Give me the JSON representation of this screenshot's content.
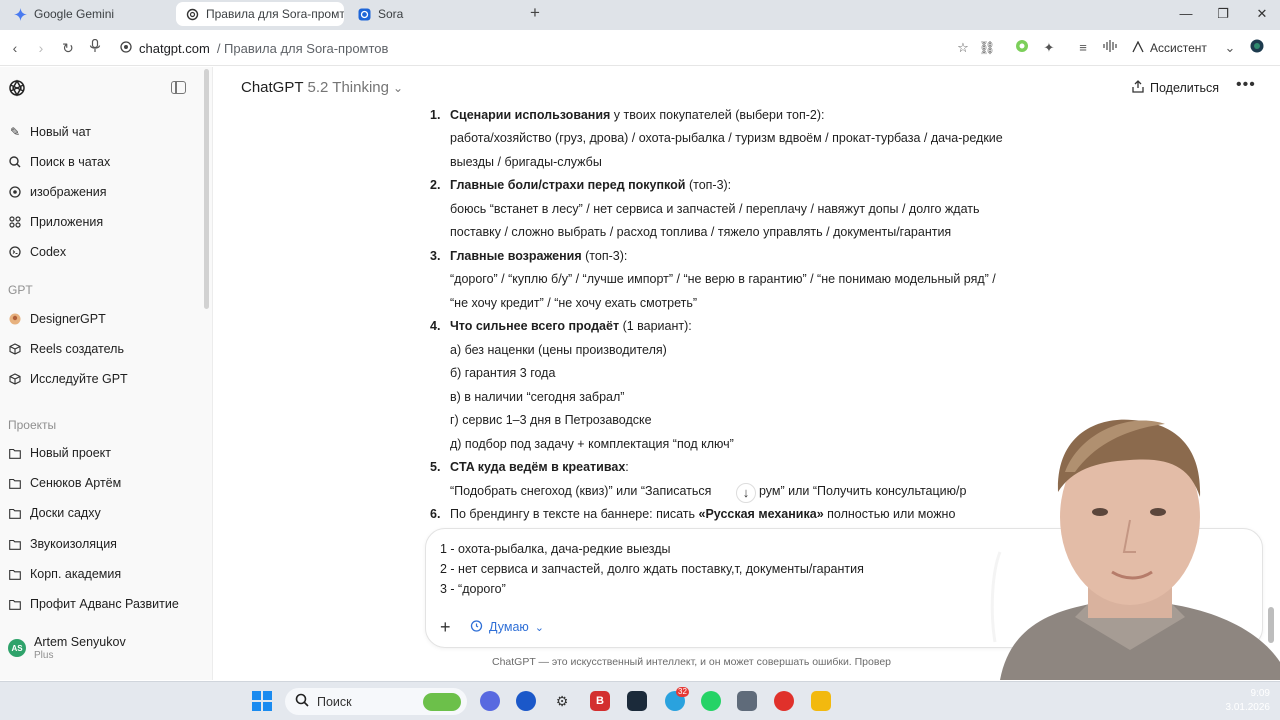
{
  "browser": {
    "tabs": [
      {
        "label": "Google Gemini",
        "icon": "gemini-icon"
      },
      {
        "label": "Правила для Sora-промто",
        "icon": "chatgpt-icon",
        "active": true
      },
      {
        "label": "Sora",
        "icon": "sora-icon"
      }
    ],
    "url_host": "chatgpt.com",
    "url_path": "/  Правила для Sora-промтов",
    "assistant_label": "Ассистент"
  },
  "sidebar": {
    "nav": [
      {
        "label": "Новый чат",
        "icon": "edit-icon"
      },
      {
        "label": "Поиск в чатах",
        "icon": "search-icon"
      },
      {
        "label": "изображения",
        "icon": "image-icon"
      },
      {
        "label": "Приложения",
        "icon": "apps-icon"
      },
      {
        "label": "Codex",
        "icon": "codex-icon"
      }
    ],
    "gpt_header": "GPT",
    "gpts": [
      {
        "label": "DesignerGPT",
        "icon": "designer-icon"
      },
      {
        "label": "Reels создатель",
        "icon": "cube-icon"
      },
      {
        "label": "Исследуйте GPT",
        "icon": "cube-icon"
      }
    ],
    "projects_header": "Проекты",
    "projects": [
      {
        "label": "Новый проект"
      },
      {
        "label": "Сенюков Артём"
      },
      {
        "label": "Доски садху"
      },
      {
        "label": "Звукоизоляция"
      },
      {
        "label": "Корп. академия"
      },
      {
        "label": "Профит Адванс Развитие"
      }
    ],
    "user": {
      "initials": "AS",
      "name": "Artem Senyukov",
      "plan": "Plus"
    }
  },
  "header": {
    "model_name": "ChatGPT",
    "model_version": "5.2 Thinking",
    "share_label": "Поделиться"
  },
  "message": {
    "n1": "1.",
    "q1_title": "Сценарии использования",
    "q1_rest": " у твоих покупателей (выбери топ-2):",
    "q1_line1": "работа/хозяйство (груз, дрова) / охота-рыбалка / туризм вдвоём / прокат-турбаза / дача-редкие",
    "q1_line2": "выезды / бригады-службы",
    "n2": "2.",
    "q2_title": "Главные боли/страхи перед покупкой",
    "q2_rest": " (топ-3):",
    "q2_line1": "боюсь “встанет в лесу” / нет сервиса и запчастей / переплачу / навяжут допы / долго ждать",
    "q2_line2": "поставку / сложно выбрать / расход топлива / тяжело управлять / документы/гарантия",
    "n3": "3.",
    "q3_title": "Главные возражения",
    "q3_rest": " (топ-3):",
    "q3_line1": "“дорого” / “куплю б/у” / “лучше импорт” / “не верю в гарантию” / “не понимаю модельный ряд” /",
    "q3_line2": "“не хочу кредит” / “не хочу ехать смотреть”",
    "n4": "4.",
    "q4_title": "Что сильнее всего продаёт",
    "q4_rest": " (1 вариант):",
    "q4_a": "а) без наценки (цены производителя)",
    "q4_b": "б) гарантия 3 года",
    "q4_c": "в) в наличии “сегодня забрал”",
    "q4_d": "г) сервис 1–3 дня в Петрозаводске",
    "q4_e": "д) подбор под задачу + комплектация “под ключ”",
    "n5": "5.",
    "q5_title": "CTA куда ведём в креативах",
    "q5_rest": ":",
    "q5_line1a": "“Подобрать снегоход (квиз)” или “Записаться",
    "q5_line1b": "рум” или “Получить консультацию/р",
    "n6": "6.",
    "q6_start": "По брендингу в тексте на баннере: писать ",
    "q6_brand": "«Русская механика»",
    "q6_end": " полностью или можно"
  },
  "composer": {
    "line1": "1 - охота-рыбалка, дача-редкие выезды",
    "line2": "2 - нет сервиса и запчастей, долго ждать поставку,т, документы/гарантия",
    "line3": "3 - “дорого”",
    "thinking_label": "Думаю"
  },
  "disclaimer": "ChatGPT — это искусственный интеллект, и он может совершать ошибки. Провер",
  "taskbar": {
    "search_placeholder": "Поиск",
    "time": "9:09",
    "date": "3.01.2026",
    "badge_count": "32"
  }
}
